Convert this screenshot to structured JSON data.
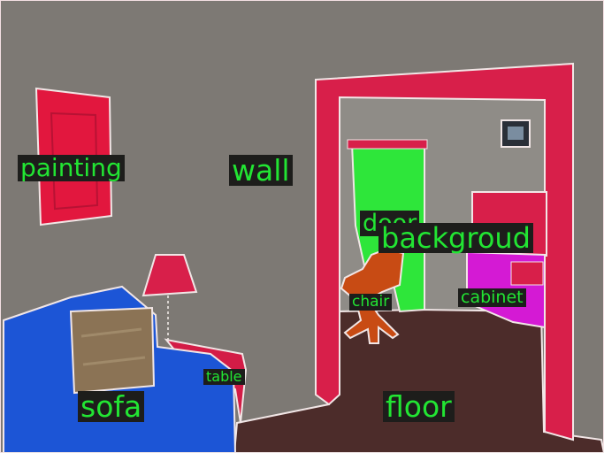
{
  "image": {
    "label_color": "#22e533",
    "regions": [
      {
        "key": "wall",
        "color": "#7d7974"
      },
      {
        "key": "painting",
        "color": "#e2173e"
      },
      {
        "key": "background",
        "color": "#d81f4a"
      },
      {
        "key": "door",
        "color": "#2ee63a"
      },
      {
        "key": "cabinet",
        "color": "#d41ad4"
      },
      {
        "key": "chair",
        "color": "#c84b14"
      },
      {
        "key": "floor",
        "color": "#4c2c2a"
      },
      {
        "key": "sofa",
        "color": "#1c55d6"
      },
      {
        "key": "table",
        "color": "#d31c46"
      }
    ]
  },
  "labels": {
    "painting": "painting",
    "wall": "wall",
    "door": "door",
    "background": "backgroud",
    "chair": "chair",
    "cabinet": "cabinet",
    "sofa": "sofa",
    "table": "table",
    "floor": "floor"
  }
}
